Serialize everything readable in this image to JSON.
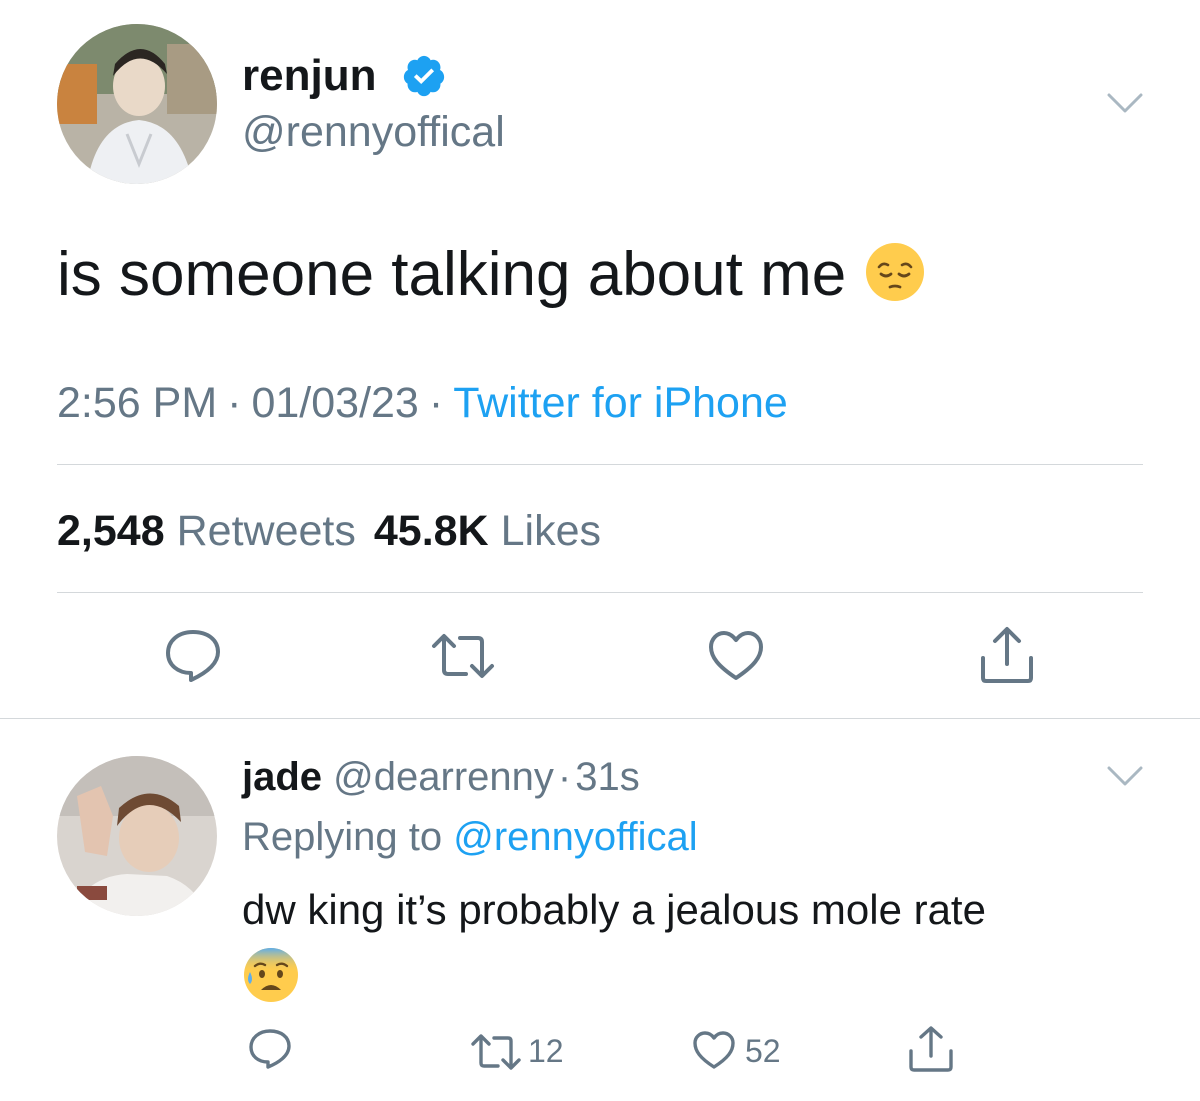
{
  "tweet": {
    "display_name": "renjun",
    "handle": "@rennyoffical",
    "text": "is someone talking about me",
    "emoji": "pensive-face",
    "time": "2:56 PM",
    "date": "01/03/23",
    "separator": "·",
    "source": "Twitter for iPhone",
    "retweets_count": "2,548",
    "retweets_label": "Retweets",
    "likes_count": "45.8K",
    "likes_label": "Likes",
    "icons": {
      "verified": "verified-badge-icon",
      "more": "chevron-down-icon",
      "reply": "reply-icon",
      "retweet": "retweet-icon",
      "like": "heart-icon",
      "share": "share-icon"
    }
  },
  "reply": {
    "display_name": "jade",
    "handle": "@dearrenny",
    "separator": "·",
    "time_ago": "31s",
    "replying_label": "Replying to",
    "replying_to": "@rennyoffical",
    "text": "dw king it’s probably a jealous mole rate",
    "emoji": "anxious-face-with-sweat",
    "retweet_count": "12",
    "like_count": "52"
  },
  "colors": {
    "link": "#1da1f2",
    "secondary_text": "#657786",
    "primary_text": "#14171a",
    "divider": "#d4d8db",
    "icon": "#657786"
  }
}
